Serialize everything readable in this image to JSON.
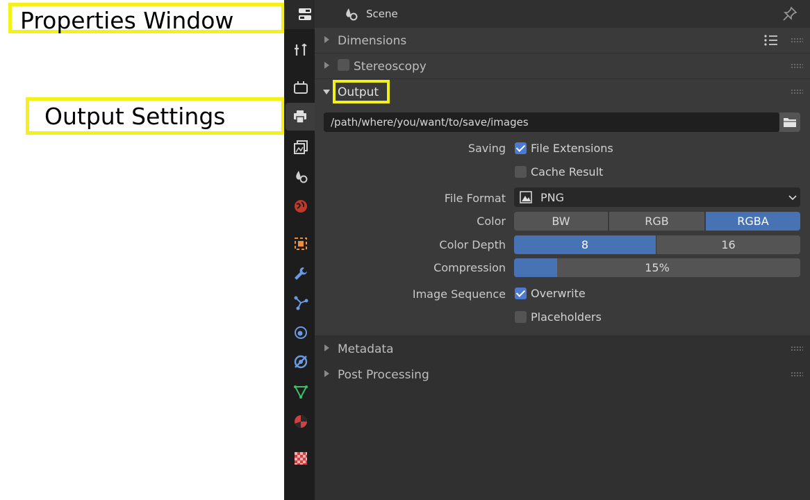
{
  "annotations": {
    "properties_window": "Properties Window",
    "output_settings": "Output Settings"
  },
  "header": {
    "title": "Scene",
    "context_icon": "scene-icon",
    "pin_icon": "pin-icon"
  },
  "tabs": [
    {
      "name": "tool-tab",
      "icon": "tool-icon"
    },
    {
      "name": "render-tab",
      "icon": "render-icon"
    },
    {
      "name": "output-tab",
      "icon": "printer-icon",
      "active": true
    },
    {
      "name": "view-layer-tab",
      "icon": "view-layer-icon"
    },
    {
      "name": "scene-tab",
      "icon": "scene-icon"
    },
    {
      "name": "world-tab",
      "icon": "world-icon"
    },
    {
      "name": "object-tab",
      "icon": "object-icon"
    },
    {
      "name": "modifier-tab",
      "icon": "wrench-icon"
    },
    {
      "name": "particles-tab",
      "icon": "particles-icon"
    },
    {
      "name": "physics-tab",
      "icon": "physics-icon"
    },
    {
      "name": "constraints-tab",
      "icon": "constraints-icon"
    },
    {
      "name": "data-tab",
      "icon": "mesh-data-icon"
    },
    {
      "name": "material-tab",
      "icon": "material-icon"
    },
    {
      "name": "texture-tab",
      "icon": "texture-icon"
    }
  ],
  "sections": {
    "dimensions": "Dimensions",
    "stereoscopy": "Stereoscopy",
    "output": "Output",
    "metadata": "Metadata",
    "post_processing": "Post Processing"
  },
  "output": {
    "path": "/path/where/you/want/to/save/images",
    "saving_label": "Saving",
    "file_extensions": {
      "label": "File Extensions",
      "checked": true
    },
    "cache_result": {
      "label": "Cache Result",
      "checked": false
    },
    "file_format_label": "File Format",
    "file_format_value": "PNG",
    "color_label": "Color",
    "color_options": [
      "BW",
      "RGB",
      "RGBA"
    ],
    "color_selected": "RGBA",
    "color_depth_label": "Color Depth",
    "color_depth_options": [
      "8",
      "16"
    ],
    "color_depth_selected": "8",
    "compression_label": "Compression",
    "compression_value": "15%",
    "compression_fraction": 0.15,
    "image_sequence_label": "Image Sequence",
    "overwrite": {
      "label": "Overwrite",
      "checked": true
    },
    "placeholders": {
      "label": "Placeholders",
      "checked": false
    }
  },
  "colors": {
    "accent": "#4772b3",
    "panel_bg": "#303030",
    "section_bg": "#3a3a3a",
    "highlight": "#f3f01a"
  }
}
